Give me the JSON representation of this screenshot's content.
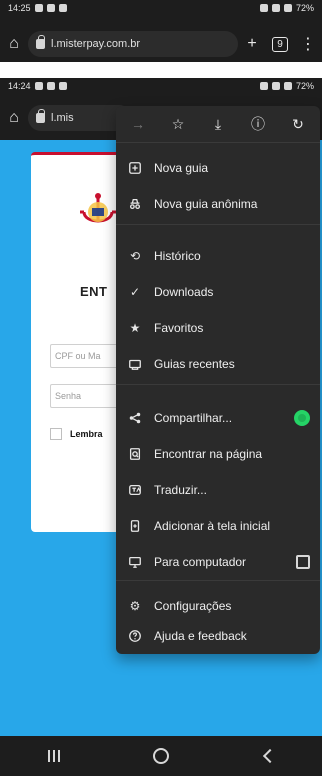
{
  "top_status": {
    "time": "14:25",
    "battery": "72%"
  },
  "top_urlbar": {
    "url": "l.misterpay.com.br",
    "new_tab": "+",
    "tabs_count": "9"
  },
  "main_status": {
    "time": "14:24",
    "battery": "72%"
  },
  "main_urlbar": {
    "url_fragment": "l.mis"
  },
  "login": {
    "heading_fragment": "ENT",
    "fields": [
      {
        "placeholder": "CPF ou Ma"
      },
      {
        "placeholder": "Senha"
      }
    ],
    "remember_label": "Lembra"
  },
  "menu": {
    "items": [
      {
        "label": "Nova guia"
      },
      {
        "label": "Nova guia anônima"
      },
      {
        "label": "Histórico"
      },
      {
        "label": "Downloads"
      },
      {
        "label": "Favoritos"
      },
      {
        "label": "Guias recentes"
      },
      {
        "label": "Compartilhar..."
      },
      {
        "label": "Encontrar na página"
      },
      {
        "label": "Traduzir..."
      },
      {
        "label": "Adicionar à tela inicial"
      },
      {
        "label": "Para computador"
      },
      {
        "label": "Configurações"
      },
      {
        "label": "Ajuda e feedback"
      }
    ]
  },
  "colors": {
    "chrome_dark": "#1d1d1d",
    "menu_bg": "#2a2a2a",
    "page_blue": "#28a7e9",
    "accent_red": "#c8102e",
    "whatsapp_green": "#25d366"
  }
}
